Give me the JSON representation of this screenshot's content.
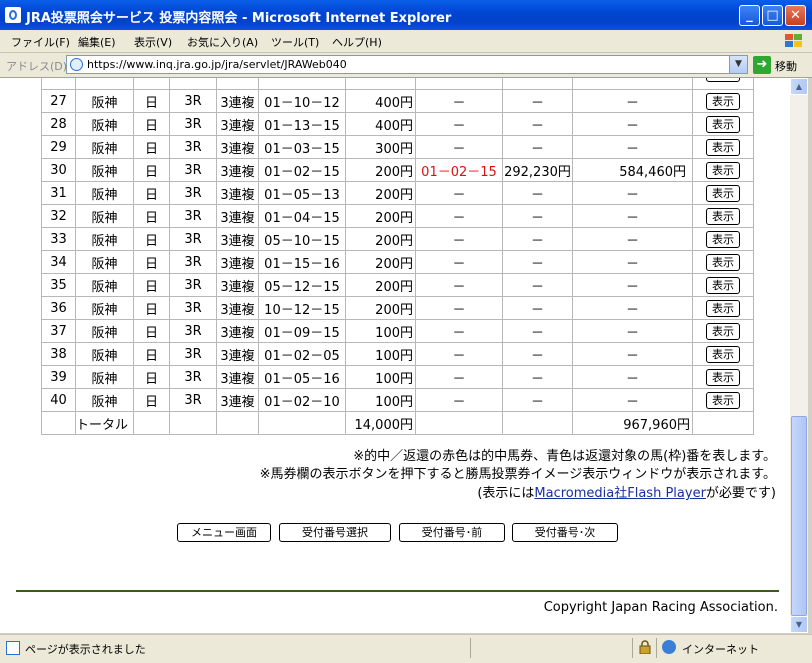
{
  "window": {
    "title": "JRA投票照会サービス 投票内容照会 - Microsoft Internet Explorer",
    "buttons": {
      "minimize": "_",
      "maximize": "□",
      "close": "✕"
    }
  },
  "menu": [
    "ファイル(F)",
    "編集(E)",
    "表示(V)",
    "お気に入り(A)",
    "ツール(T)",
    "ヘルプ(H)"
  ],
  "address": {
    "label": "アドレス(D)",
    "url": "https://www.inq.jra.go.jp/jra/servlet/JRAWeb040",
    "go_label": "移動"
  },
  "table": {
    "rows": [
      {
        "no": "27",
        "place": "阪神",
        "day": "日",
        "race": "3R",
        "bet_type": "3連複",
        "combo": "01－10－12",
        "amount": "400円",
        "hit_combo": "－",
        "payout_unit": "－",
        "refund": "－",
        "btn": "表示"
      },
      {
        "no": "28",
        "place": "阪神",
        "day": "日",
        "race": "3R",
        "bet_type": "3連複",
        "combo": "01－13－15",
        "amount": "400円",
        "hit_combo": "－",
        "payout_unit": "－",
        "refund": "－",
        "btn": "表示"
      },
      {
        "no": "29",
        "place": "阪神",
        "day": "日",
        "race": "3R",
        "bet_type": "3連複",
        "combo": "01－03－15",
        "amount": "300円",
        "hit_combo": "－",
        "payout_unit": "－",
        "refund": "－",
        "btn": "表示"
      },
      {
        "no": "30",
        "place": "阪神",
        "day": "日",
        "race": "3R",
        "bet_type": "3連複",
        "combo": "01－02－15",
        "amount": "200円",
        "hit_combo": "01－02－15",
        "payout_unit": "292,230円",
        "refund": "584,460円",
        "btn": "表示",
        "hit": true
      },
      {
        "no": "31",
        "place": "阪神",
        "day": "日",
        "race": "3R",
        "bet_type": "3連複",
        "combo": "01－05－13",
        "amount": "200円",
        "hit_combo": "－",
        "payout_unit": "－",
        "refund": "－",
        "btn": "表示"
      },
      {
        "no": "32",
        "place": "阪神",
        "day": "日",
        "race": "3R",
        "bet_type": "3連複",
        "combo": "01－04－15",
        "amount": "200円",
        "hit_combo": "－",
        "payout_unit": "－",
        "refund": "－",
        "btn": "表示"
      },
      {
        "no": "33",
        "place": "阪神",
        "day": "日",
        "race": "3R",
        "bet_type": "3連複",
        "combo": "05－10－15",
        "amount": "200円",
        "hit_combo": "－",
        "payout_unit": "－",
        "refund": "－",
        "btn": "表示"
      },
      {
        "no": "34",
        "place": "阪神",
        "day": "日",
        "race": "3R",
        "bet_type": "3連複",
        "combo": "01－15－16",
        "amount": "200円",
        "hit_combo": "－",
        "payout_unit": "－",
        "refund": "－",
        "btn": "表示"
      },
      {
        "no": "35",
        "place": "阪神",
        "day": "日",
        "race": "3R",
        "bet_type": "3連複",
        "combo": "05－12－15",
        "amount": "200円",
        "hit_combo": "－",
        "payout_unit": "－",
        "refund": "－",
        "btn": "表示"
      },
      {
        "no": "36",
        "place": "阪神",
        "day": "日",
        "race": "3R",
        "bet_type": "3連複",
        "combo": "10－12－15",
        "amount": "200円",
        "hit_combo": "－",
        "payout_unit": "－",
        "refund": "－",
        "btn": "表示"
      },
      {
        "no": "37",
        "place": "阪神",
        "day": "日",
        "race": "3R",
        "bet_type": "3連複",
        "combo": "01－09－15",
        "amount": "100円",
        "hit_combo": "－",
        "payout_unit": "－",
        "refund": "－",
        "btn": "表示"
      },
      {
        "no": "38",
        "place": "阪神",
        "day": "日",
        "race": "3R",
        "bet_type": "3連複",
        "combo": "01－02－05",
        "amount": "100円",
        "hit_combo": "－",
        "payout_unit": "－",
        "refund": "－",
        "btn": "表示"
      },
      {
        "no": "39",
        "place": "阪神",
        "day": "日",
        "race": "3R",
        "bet_type": "3連複",
        "combo": "01－05－16",
        "amount": "100円",
        "hit_combo": "－",
        "payout_unit": "－",
        "refund": "－",
        "btn": "表示"
      },
      {
        "no": "40",
        "place": "阪神",
        "day": "日",
        "race": "3R",
        "bet_type": "3連複",
        "combo": "01－02－10",
        "amount": "100円",
        "hit_combo": "－",
        "payout_unit": "－",
        "refund": "－",
        "btn": "表示"
      }
    ],
    "total": {
      "label": "トータル",
      "amount": "14,000円",
      "refund": "967,960円"
    },
    "hit_color": "#dd1111"
  },
  "notes": {
    "line1": "※的中／返還の赤色は的中馬券、青色は返還対象の馬(枠)番を表します。",
    "line2": "※馬券欄の表示ボタンを押下すると勝馬投票券イメージ表示ウィンドウが表示されます。",
    "line3_before": "(表示には",
    "line3_link": "Macromedia社Flash Player",
    "line3_after": "が必要です)"
  },
  "buttons": {
    "menu": "メニュー画面",
    "select": "受付番号選択",
    "prev": "受付番号･前",
    "next": "受付番号･次"
  },
  "copyright": "Copyright Japan Racing Association.",
  "status": {
    "text": "ページが表示されました",
    "zone": "インターネット"
  }
}
